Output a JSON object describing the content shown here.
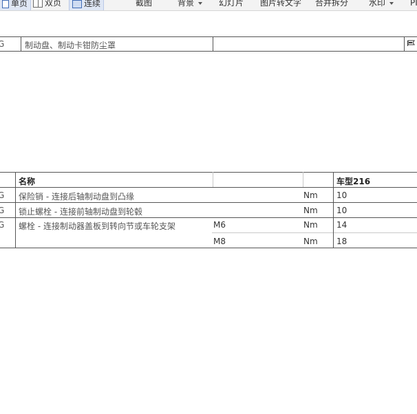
{
  "toolbar": {
    "single_page": "单页",
    "double_page": "双页",
    "continuous": "连续",
    "screenshot": "截图",
    "background": "背景",
    "slideshow": "幻灯片",
    "image_to_text": "图片转文字",
    "merge_split": "合并拆分",
    "watermark": "水印",
    "cutoff": "PI"
  },
  "top_table": {
    "code": "G",
    "description": "制动盘、制动卡钳防尘罩",
    "icon": "flag-icon"
  },
  "torque_table": {
    "header": {
      "name": "名称",
      "model": "车型216"
    },
    "rows": [
      {
        "code": "G",
        "name": "保险销 - 连接后轴制动盘到凸缘",
        "spec": "",
        "unit": "Nm",
        "value": "10"
      },
      {
        "code": "G",
        "name": "锁止螺栓 - 连接前轴制动盘到轮毂",
        "spec": "",
        "unit": "Nm",
        "value": "10"
      },
      {
        "code": "G",
        "name": "螺栓 - 连接制动器盖板到转向节或车轮支架",
        "spec": "M6",
        "unit": "Nm",
        "value": "14"
      },
      {
        "code": "",
        "name": "",
        "spec": "M8",
        "unit": "Nm",
        "value": "18"
      }
    ]
  }
}
